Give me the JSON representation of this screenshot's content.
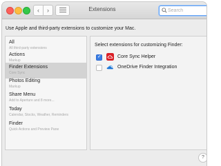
{
  "window": {
    "title": "Extensions"
  },
  "toolbar": {
    "back_icon": "chevron-left-icon",
    "forward_icon": "chevron-right-icon",
    "grid_icon": "show-all-grid-icon",
    "search": {
      "placeholder": "Search",
      "value": ""
    }
  },
  "intro_text": "Use Apple and third-party extensions to customize your Mac.",
  "sidebar": {
    "items": [
      {
        "title": "All",
        "subtitle": "All third-party extensions",
        "selected": false
      },
      {
        "title": "Actions",
        "subtitle": "Markup",
        "selected": false
      },
      {
        "title": "Finder Extensions",
        "subtitle": "Core Sync",
        "selected": true
      },
      {
        "title": "Photos Editing",
        "subtitle": "Markup",
        "selected": false
      },
      {
        "title": "Share Menu",
        "subtitle": "Add to Aperture and 8 more...",
        "selected": false
      },
      {
        "title": "Today",
        "subtitle": "Calendar, Stocks, Weather, Reminders",
        "selected": false
      },
      {
        "title": "Finder",
        "subtitle": "Quick Actions and Preview Pane",
        "selected": false
      }
    ]
  },
  "content": {
    "heading": "Select extensions for customizing Finder:",
    "extensions": [
      {
        "label": "Core Sync Helper",
        "checked": true,
        "icon": "creative-cloud-icon"
      },
      {
        "label": "OneDrive Finder Integration",
        "checked": false,
        "icon": "onedrive-cloud-icon"
      }
    ]
  },
  "help_label": "?",
  "colors": {
    "accent": "#3a7ee4",
    "selected_row": "#d3d3d3",
    "close": "#fc605b",
    "minimize": "#fdbc40",
    "maximize": "#34c84a"
  }
}
